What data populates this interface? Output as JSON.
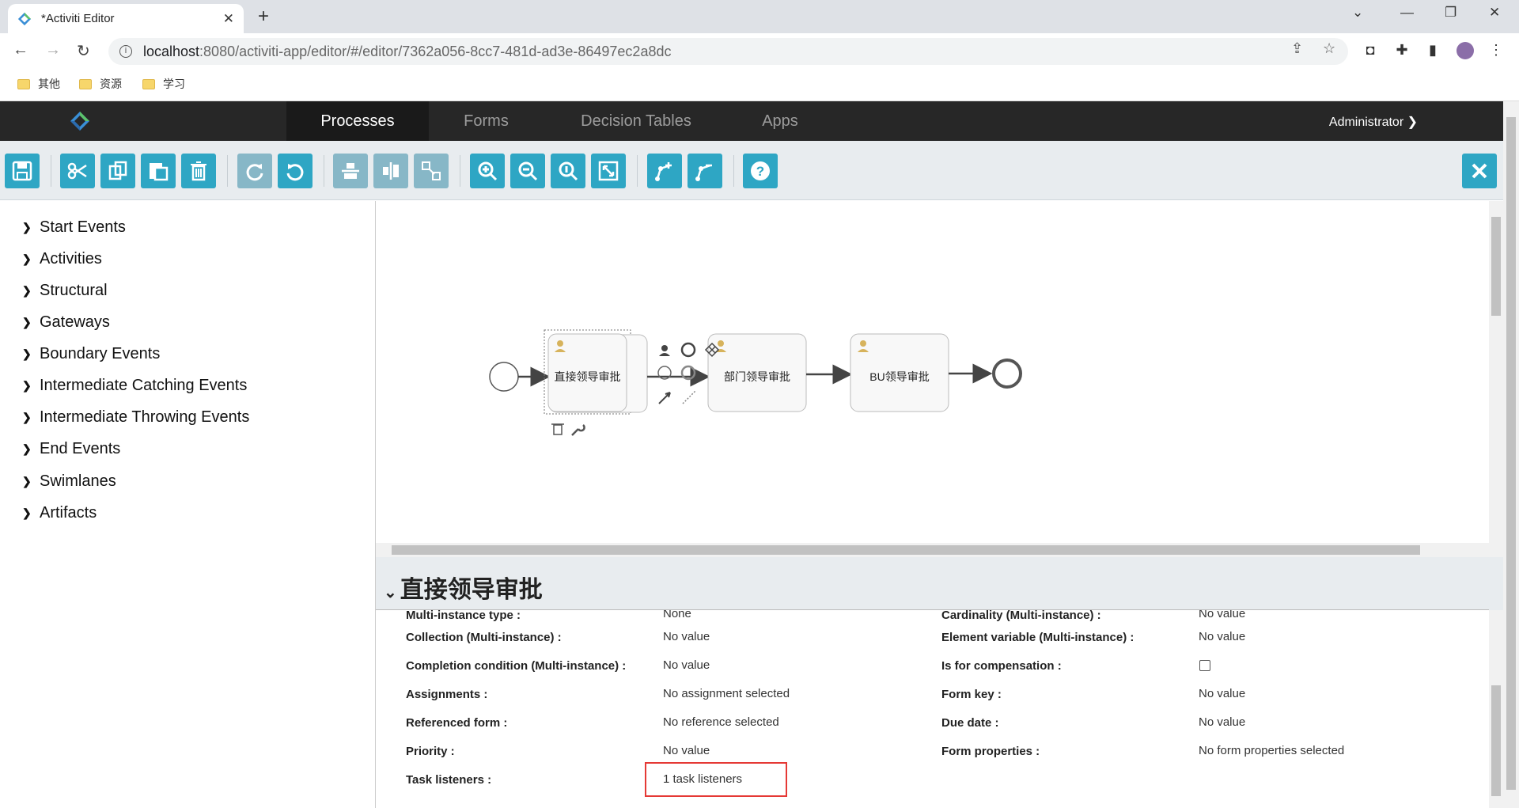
{
  "browser": {
    "tab_title": "*Activiti Editor",
    "url_host": "localhost",
    "url_path": ":8080/activiti-app/editor/#/editor/7362a056-8cc7-481d-ad3e-86497ec2a8dc",
    "bookmarks": [
      "其他",
      "资源",
      "学习"
    ]
  },
  "app_nav": {
    "items": [
      "Processes",
      "Forms",
      "Decision Tables",
      "Apps"
    ],
    "active": "Processes",
    "user": "Administrator"
  },
  "toolbar": {
    "buttons": [
      "save-icon",
      "cut-icon",
      "copy-icon",
      "paste-icon",
      "delete-icon",
      "redo-icon",
      "undo-icon",
      "align-vertical-icon",
      "align-horizontal-icon",
      "same-size-icon",
      "zoom-in-icon",
      "zoom-out-icon",
      "zoom-actual-icon",
      "zoom-fit-icon",
      "add-bendpoint-icon",
      "remove-bendpoint-icon",
      "help-icon",
      "close-icon"
    ],
    "accent": "#2ea6c4"
  },
  "palette": {
    "groups": [
      "Start Events",
      "Activities",
      "Structural",
      "Gateways",
      "Boundary Events",
      "Intermediate Catching Events",
      "Intermediate Throwing Events",
      "End Events",
      "Swimlanes",
      "Artifacts"
    ]
  },
  "diagram": {
    "tasks": [
      "直接领导审批",
      "部门领导审批",
      "BU领导审批"
    ]
  },
  "properties": {
    "title": "直接领导审批",
    "left": [
      {
        "label": "Multi-instance type :",
        "value": "None"
      },
      {
        "label": "Collection (Multi-instance) :",
        "value": "No value"
      },
      {
        "label": "Completion condition (Multi-instance) :",
        "value": "No value"
      },
      {
        "label": "Assignments :",
        "value": "No assignment selected"
      },
      {
        "label": "Referenced form :",
        "value": "No reference selected"
      },
      {
        "label": "Priority :",
        "value": "No value"
      },
      {
        "label": "Task listeners :",
        "value": "1 task listeners"
      }
    ],
    "right": [
      {
        "label": "Cardinality (Multi-instance) :",
        "value": "No value"
      },
      {
        "label": "Element variable (Multi-instance) :",
        "value": "No value"
      },
      {
        "label": "Is for compensation :",
        "value": ""
      },
      {
        "label": "Form key :",
        "value": "No value"
      },
      {
        "label": "Due date :",
        "value": "No value"
      },
      {
        "label": "Form properties :",
        "value": "No form properties selected"
      }
    ],
    "highlight_color": "#e53935"
  }
}
